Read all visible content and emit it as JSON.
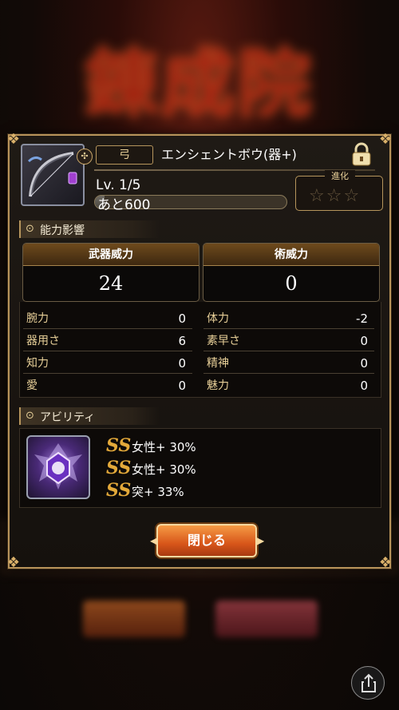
{
  "colors": {
    "gold": "#e7cf98",
    "frame": "#b8935a",
    "accent_orange": "#e3a93a",
    "button": "#d8561a"
  },
  "background": {
    "banner_text": "錬成院"
  },
  "weapon": {
    "type": "弓",
    "name": "エンシェントボウ(器+)",
    "level": "Lv. 1/5",
    "exp_text": "あと600",
    "exp_fraction": 0.05,
    "evolution_label": "進化",
    "evolution_stars": "☆☆☆",
    "locked": true,
    "icon": "bow-icon",
    "badge_icon": "attribute-badge-icon"
  },
  "stats_section": {
    "title": "能力影響",
    "weapon_power_label": "武器威力",
    "weapon_power_value": "24",
    "art_power_label": "術威力",
    "art_power_value": "0",
    "left": [
      {
        "label": "腕力",
        "value": "0"
      },
      {
        "label": "器用さ",
        "value": "6"
      },
      {
        "label": "知力",
        "value": "0"
      },
      {
        "label": "愛",
        "value": "0"
      }
    ],
    "right": [
      {
        "label": "体力",
        "value": "-2"
      },
      {
        "label": "素早さ",
        "value": "0"
      },
      {
        "label": "精神",
        "value": "0"
      },
      {
        "label": "魅力",
        "value": "0"
      }
    ]
  },
  "ability_section": {
    "title": "アビリティ",
    "icon": "ability-emblem-icon",
    "rows": [
      {
        "symbol": "SS",
        "text": "女性+ 30%"
      },
      {
        "symbol": "SS",
        "text": "女性+ 30%"
      },
      {
        "symbol": "SS",
        "text": "突+ 33%"
      }
    ]
  },
  "buttons": {
    "close": "閉じる"
  },
  "share": {
    "icon": "share-icon"
  }
}
